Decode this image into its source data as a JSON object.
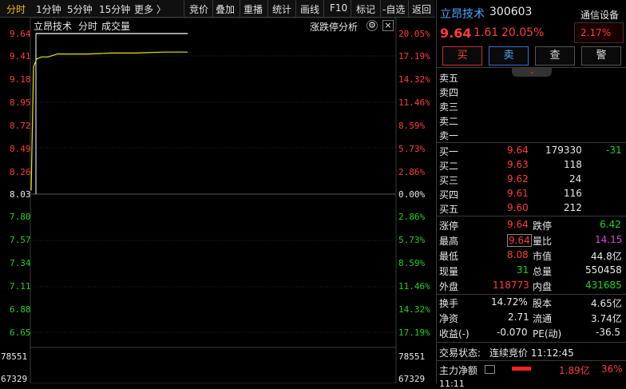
{
  "toolbar": {
    "period_tabs": [
      "分时",
      "1分钟",
      "5分钟",
      "15分钟",
      "更多 〉"
    ],
    "buttons": [
      "竞价",
      "叠加",
      "重播",
      "统计",
      "画线",
      "F10",
      "标记",
      "-自选",
      "返回"
    ]
  },
  "chart": {
    "stock_label": "立昂技术",
    "mode_label": "分时",
    "volume_label": "成交量",
    "analysis_label": "涨跌停分析",
    "gear_icon": "gear-icon",
    "close_icon": "close-icon",
    "price_ticks": [
      "9.64",
      "9.41",
      "9.18",
      "8.95",
      "8.72",
      "8.49",
      "8.26",
      "8.03",
      "7.80",
      "7.57",
      "7.34",
      "7.11",
      "6.88",
      "6.65"
    ],
    "pct_ticks": [
      "20.05%",
      "17.19%",
      "14.32%",
      "11.46%",
      "8.59%",
      "5.73%",
      "2.86%",
      "0.00%",
      "2.86%",
      "5.73%",
      "8.59%",
      "11.46%",
      "14.32%",
      "17.19%"
    ],
    "vol_ticks": [
      "78551",
      "67329"
    ],
    "colors": {
      "up": "#ff3b3b",
      "down": "#1fd31f",
      "price_line": "#e8e800",
      "avg_line": "#ffffff"
    }
  },
  "chart_data": {
    "type": "line",
    "title": "",
    "xlabel": "",
    "ylabel": "",
    "ylim": [
      6.42,
      9.64
    ],
    "series": [
      {
        "name": "",
        "values": [
          8.03,
          9.3,
          9.38,
          9.4,
          9.4,
          9.43,
          9.43,
          9.43,
          9.44,
          9.44,
          9.45,
          9.45
        ]
      }
    ]
  },
  "quote": {
    "name": "立昂技术",
    "code": "300603",
    "sector": "通信设备",
    "sector_change": "2.17%",
    "price": "9.64",
    "change": "1.61",
    "change_pct": "20.05%",
    "buy_label": "买",
    "sell_label": "卖",
    "query_label": "查",
    "alert_label": "警",
    "asks": [
      {
        "label": "卖五",
        "price": "",
        "volume": ""
      },
      {
        "label": "卖四",
        "price": "",
        "volume": ""
      },
      {
        "label": "卖三",
        "price": "",
        "volume": ""
      },
      {
        "label": "卖二",
        "price": "",
        "volume": ""
      },
      {
        "label": "卖一",
        "price": "",
        "volume": ""
      }
    ],
    "bids": [
      {
        "label": "买一",
        "price": "9.64",
        "volume": "179330",
        "change": "-31"
      },
      {
        "label": "买二",
        "price": "9.63",
        "volume": "118",
        "change": ""
      },
      {
        "label": "买三",
        "price": "9.62",
        "volume": "24",
        "change": ""
      },
      {
        "label": "买四",
        "price": "9.61",
        "volume": "116",
        "change": ""
      },
      {
        "label": "买五",
        "price": "9.60",
        "volume": "212",
        "change": ""
      }
    ],
    "stats": {
      "limit_up_label": "涨停",
      "limit_up": "9.64",
      "limit_down_label": "跌停",
      "limit_down": "6.42",
      "high_label": "最高",
      "high": "9.64",
      "vol_ratio_label": "量比",
      "vol_ratio": "14.15",
      "low_label": "最低",
      "low": "8.08",
      "mktcap_label": "市值",
      "mktcap": "44.8亿",
      "cur_vol_label": "现量",
      "cur_vol": "31",
      "total_vol_label": "总量",
      "total_vol": "550458",
      "outer_label": "外盘",
      "outer": "118773",
      "inner_label": "内盘",
      "inner": "431685"
    },
    "fundamentals": {
      "turnover_label": "换手",
      "turnover": "14.72%",
      "share_cap_label": "股本",
      "share_cap": "4.65亿",
      "nav_label": "净资",
      "nav": "2.71",
      "float_label": "流通",
      "float": "3.74亿",
      "eps_label": "收益(-)",
      "eps": "-0.070",
      "pe_label": "PE(动)",
      "pe": "-36.5"
    },
    "status_label": "交易状态:",
    "status": "连续竞价 11:12:45",
    "mainflow_label": "主力净额",
    "mainflow": "1.89亿",
    "mainflow_pct": "36%",
    "last_tick_time": "11:11"
  }
}
